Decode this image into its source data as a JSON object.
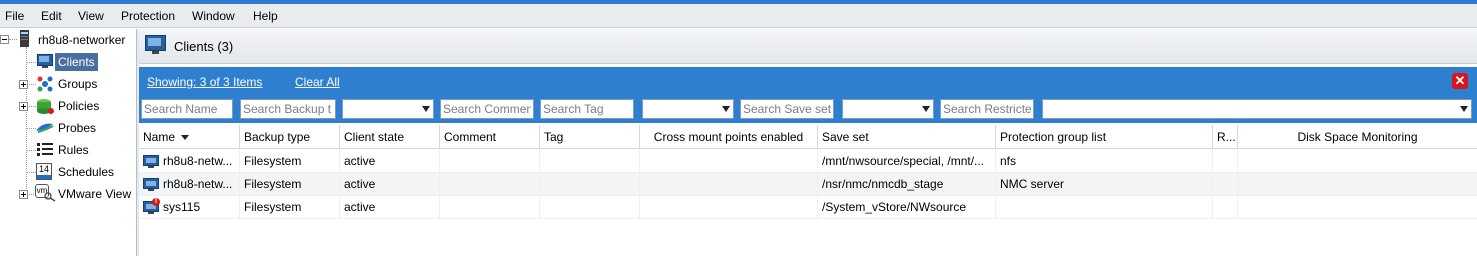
{
  "menubar": [
    "File",
    "Edit",
    "View",
    "Protection",
    "Window",
    "Help"
  ],
  "tree": {
    "root": "rh8u8-networker",
    "items": [
      {
        "label": "Clients",
        "icon": "monitor-icon",
        "selected": true
      },
      {
        "label": "Groups",
        "icon": "groups-icon"
      },
      {
        "label": "Policies",
        "icon": "policies-icon"
      },
      {
        "label": "Probes",
        "icon": "probes-icon"
      },
      {
        "label": "Rules",
        "icon": "rules-icon"
      },
      {
        "label": "Schedules",
        "icon": "calendar-icon",
        "icon_text": "14"
      },
      {
        "label": "VMware View",
        "icon": "vmware-icon",
        "icon_text": "vm"
      }
    ]
  },
  "panel": {
    "title": "Clients (3)"
  },
  "filter": {
    "showing": "Showing: 3 of 3 Items",
    "clear_all": "Clear All",
    "placeholders": {
      "name": "Search Name",
      "backup": "Search Backup t",
      "comment": "Search Commen",
      "tag": "Search Tag",
      "saveset": "Search Save set",
      "restrict": "Search Restricte"
    }
  },
  "table": {
    "headers": {
      "name": "Name",
      "backup_type": "Backup type",
      "client_state": "Client state",
      "comment": "Comment",
      "tag": "Tag",
      "cross_mount": "Cross mount points enabled",
      "save_set": "Save set",
      "protection_group": "Protection group list",
      "r": "R...",
      "disk_space": "Disk Space Monitoring"
    },
    "rows": [
      {
        "name": "rh8u8-netw...",
        "backup_type": "Filesystem",
        "client_state": "active",
        "save_set": "/mnt/nwsource/special, /mnt/...",
        "protection_group": "nfs",
        "alert": false
      },
      {
        "name": "rh8u8-netw...",
        "backup_type": "Filesystem",
        "client_state": "active",
        "save_set": "/nsr/nmc/nmcdb_stage",
        "protection_group": "NMC server",
        "alert": false
      },
      {
        "name": "sys115",
        "backup_type": "Filesystem",
        "client_state": "active",
        "save_set": "/System_vStore/NWsource",
        "protection_group": "",
        "alert": true
      }
    ]
  }
}
